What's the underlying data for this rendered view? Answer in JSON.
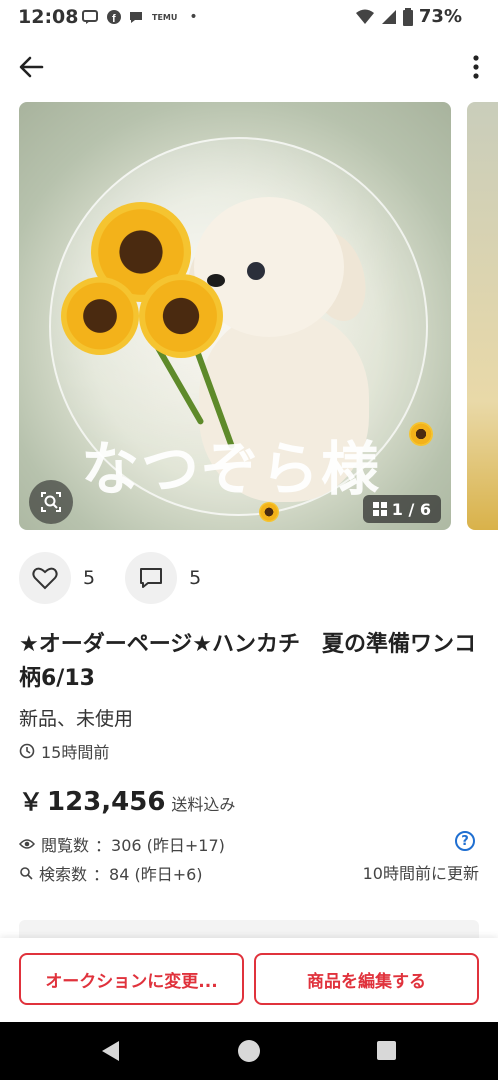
{
  "status_bar": {
    "time": "12:08",
    "notification_icons": [
      "message-icon",
      "facebook-icon",
      "chat-icon",
      "temu-icon",
      "dot-icon"
    ],
    "temu_label": "TEMU",
    "battery": "73%"
  },
  "product": {
    "image_watermark": "なつぞら様",
    "image_counter": "1 / 6",
    "likes": "5",
    "comments": "5",
    "title": "★オーダーページ★ハンカチ　夏の準備ワンコ柄6/13",
    "condition": "新品、未使用",
    "posted": "15時間前",
    "price_symbol": "￥",
    "price": "123,456",
    "shipping": "送料込み",
    "views_label": "閲覧数",
    "views_value": "：306 (昨日+17)",
    "searches_label": "検索数",
    "searches_value": "：84 (昨日+6)",
    "updated": "10時間前に更新"
  },
  "actions": {
    "auction_button": "オークションに変更...",
    "edit_button": "商品を編集する"
  },
  "colors": {
    "accent": "#e0323c",
    "help": "#1f6fd1"
  }
}
